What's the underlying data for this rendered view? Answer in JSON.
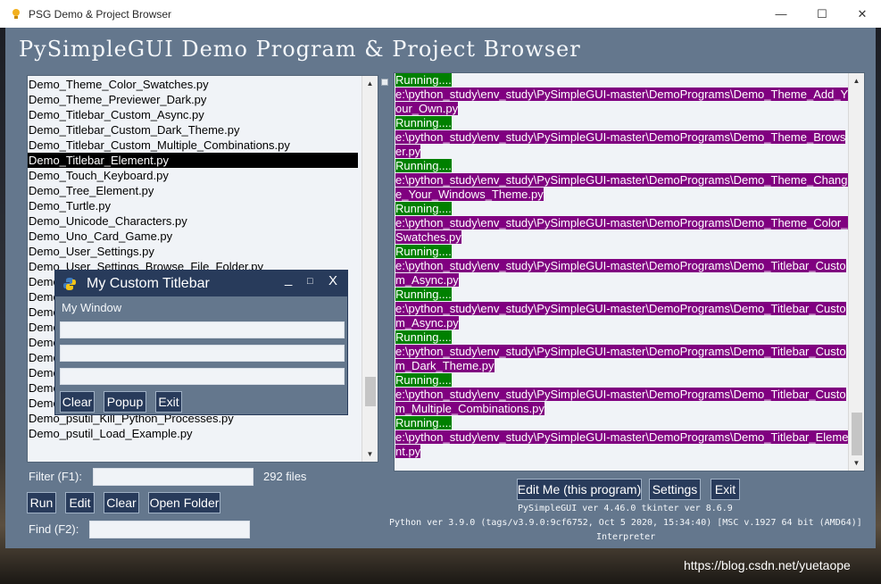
{
  "window": {
    "title": "PSG Demo & Project Browser",
    "minimize": "—",
    "maximize": "☐",
    "close": "✕"
  },
  "main": {
    "heading": "PySimpleGUI Demo Program & Project Browser"
  },
  "file_list": {
    "items": [
      "Demo_Theme_Color_Swatches.py",
      "Demo_Theme_Previewer_Dark.py",
      "Demo_Titlebar_Custom_Async.py",
      "Demo_Titlebar_Custom_Dark_Theme.py",
      "Demo_Titlebar_Custom_Multiple_Combinations.py",
      "Demo_Titlebar_Element.py",
      "Demo_Touch_Keyboard.py",
      "Demo_Tree_Element.py",
      "Demo_Turtle.py",
      "Demo_Unicode_Characters.py",
      "Demo_Uno_Card_Game.py",
      "Demo_User_Settings.py",
      "Demo_User_Settings_Browse_File_Folder.py",
      "Demo_User_Settings_Class.py",
      "Demo_User_Settings_Class_Remember_Input.py",
      "Demo_Watermark_Window.py",
      "Demo_Window_Disappear.py",
      "Demo_Window_Location.py",
      "Demo_Window_Open_Multiple_Times.py",
      "Demo_YouTube_Intro.py",
      "Demo_psgtray_Tray_Icon_Tkinter.py",
      "Demo_psutil_Kill_Processes.py",
      "Demo_psutil_Kill_Python_Processes.py",
      "Demo_psutil_Load_Example.py"
    ],
    "selected_index": 5
  },
  "output": {
    "lines": [
      {
        "kind": "run",
        "text": "Running...."
      },
      {
        "kind": "path",
        "text": "e:\\python_study\\env_study\\PySimpleGUI-master\\DemoPrograms\\Demo_Theme_Add_Y"
      },
      {
        "kind": "path",
        "text": "our_Own.py"
      },
      {
        "kind": "run",
        "text": "Running...."
      },
      {
        "kind": "path",
        "text": "e:\\python_study\\env_study\\PySimpleGUI-master\\DemoPrograms\\Demo_Theme_Brows"
      },
      {
        "kind": "path",
        "text": "er.py"
      },
      {
        "kind": "run",
        "text": "Running...."
      },
      {
        "kind": "path",
        "text": "e:\\python_study\\env_study\\PySimpleGUI-master\\DemoPrograms\\Demo_Theme_Chang"
      },
      {
        "kind": "path",
        "text": "e_Your_Windows_Theme.py"
      },
      {
        "kind": "run",
        "text": "Running...."
      },
      {
        "kind": "path",
        "text": "e:\\python_study\\env_study\\PySimpleGUI-master\\DemoPrograms\\Demo_Theme_Color_"
      },
      {
        "kind": "path",
        "text": "Swatches.py"
      },
      {
        "kind": "run",
        "text": "Running...."
      },
      {
        "kind": "path",
        "text": "e:\\python_study\\env_study\\PySimpleGUI-master\\DemoPrograms\\Demo_Titlebar_Custo"
      },
      {
        "kind": "path",
        "text": "m_Async.py"
      },
      {
        "kind": "run",
        "text": "Running...."
      },
      {
        "kind": "path",
        "text": "e:\\python_study\\env_study\\PySimpleGUI-master\\DemoPrograms\\Demo_Titlebar_Custo"
      },
      {
        "kind": "path",
        "text": "m_Async.py"
      },
      {
        "kind": "run",
        "text": "Running...."
      },
      {
        "kind": "path",
        "text": "e:\\python_study\\env_study\\PySimpleGUI-master\\DemoPrograms\\Demo_Titlebar_Custo"
      },
      {
        "kind": "path",
        "text": "m_Dark_Theme.py"
      },
      {
        "kind": "run",
        "text": "Running...."
      },
      {
        "kind": "path",
        "text": "e:\\python_study\\env_study\\PySimpleGUI-master\\DemoPrograms\\Demo_Titlebar_Custo"
      },
      {
        "kind": "path",
        "text": "m_Multiple_Combinations.py"
      },
      {
        "kind": "run",
        "text": "Running...."
      },
      {
        "kind": "path",
        "text": "e:\\python_study\\env_study\\PySimpleGUI-master\\DemoPrograms\\Demo_Titlebar_Eleme"
      },
      {
        "kind": "path",
        "text": "nt.py"
      }
    ]
  },
  "controls": {
    "filter_label": "Filter (F1):",
    "filter_value": "",
    "file_count": "292 files",
    "run": "Run",
    "edit": "Edit",
    "clear": "Clear",
    "open_folder": "Open Folder",
    "find_label": "Find (F2):",
    "find_value": "",
    "edit_me": "Edit Me (this program)",
    "settings": "Settings",
    "exit": "Exit"
  },
  "version": {
    "line1": "PySimpleGUI ver 4.46.0  tkinter ver 8.6.9",
    "line2": "Python ver 3.9.0 (tags/v3.9.0:9cf6752, Oct  5 2020, 15:34:40) [MSC v.1927 64 bit (AMD64)]",
    "line3": "Interpreter"
  },
  "popup": {
    "title": "My Custom Titlebar",
    "minimize": "_",
    "maximize": "□",
    "close": "X",
    "label": "My Window",
    "input1": "",
    "input2": "",
    "input3": "",
    "clear": "Clear",
    "popup": "Popup",
    "exit": "Exit"
  },
  "watermark": "https://blog.csdn.net/yuetaope",
  "colors": {
    "window_bg": "#64778d",
    "button_bg": "#283b5b",
    "selection_bg": "#000000",
    "running_bg": "#008000",
    "path_bg": "#800080"
  }
}
